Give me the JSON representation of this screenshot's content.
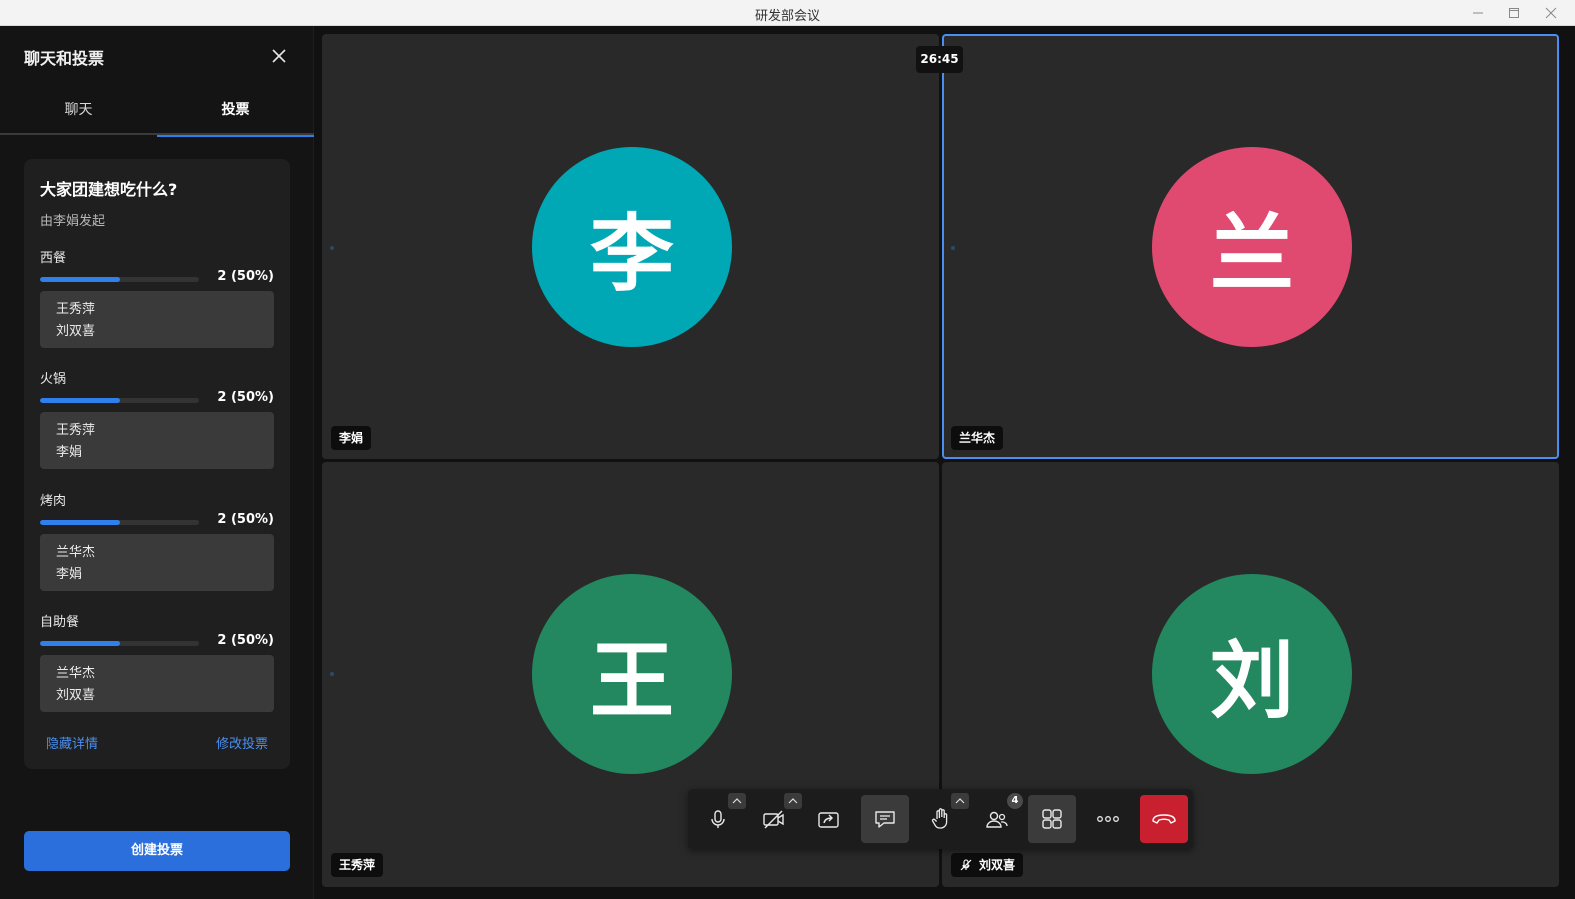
{
  "window": {
    "title": "研发部会议"
  },
  "sidebar": {
    "title": "聊天和投票",
    "tabs": [
      {
        "label": "聊天"
      },
      {
        "label": "投票"
      }
    ],
    "poll": {
      "question": "大家团建想吃什么?",
      "initiator": "由李娟发起",
      "options": [
        {
          "name": "西餐",
          "percent_label": "2 (50%)",
          "fraction": 0.5,
          "voters": [
            "王秀萍",
            "刘双喜"
          ]
        },
        {
          "name": "火锅",
          "percent_label": "2 (50%)",
          "fraction": 0.5,
          "voters": [
            "王秀萍",
            "李娟"
          ]
        },
        {
          "name": "烤肉",
          "percent_label": "2 (50%)",
          "fraction": 0.5,
          "voters": [
            "兰华杰",
            "李娟"
          ]
        },
        {
          "name": "自助餐",
          "percent_label": "2 (50%)",
          "fraction": 0.5,
          "voters": [
            "兰华杰",
            "刘双喜"
          ]
        }
      ],
      "hide_details": "隐藏详情",
      "edit_vote": "修改投票"
    },
    "create_button": "创建投票"
  },
  "meeting": {
    "timer": "26:45",
    "participants": [
      {
        "initial": "李",
        "name": "李娟",
        "color": "#00a8b5",
        "muted": false,
        "active": false
      },
      {
        "initial": "兰",
        "name": "兰华杰",
        "color": "#e04a70",
        "muted": false,
        "active": true
      },
      {
        "initial": "王",
        "name": "王秀萍",
        "color": "#238760",
        "muted": false,
        "active": false
      },
      {
        "initial": "刘",
        "name": "刘双喜",
        "color": "#238760",
        "muted": true,
        "active": false
      }
    ]
  },
  "toolbar": {
    "participant_count": "4",
    "icons": [
      "microphone-icon",
      "camera-off-icon",
      "share-screen-icon",
      "chat-icon",
      "raise-hand-icon",
      "participants-icon",
      "grid-layout-icon",
      "more-icon",
      "hang-up-icon"
    ]
  }
}
